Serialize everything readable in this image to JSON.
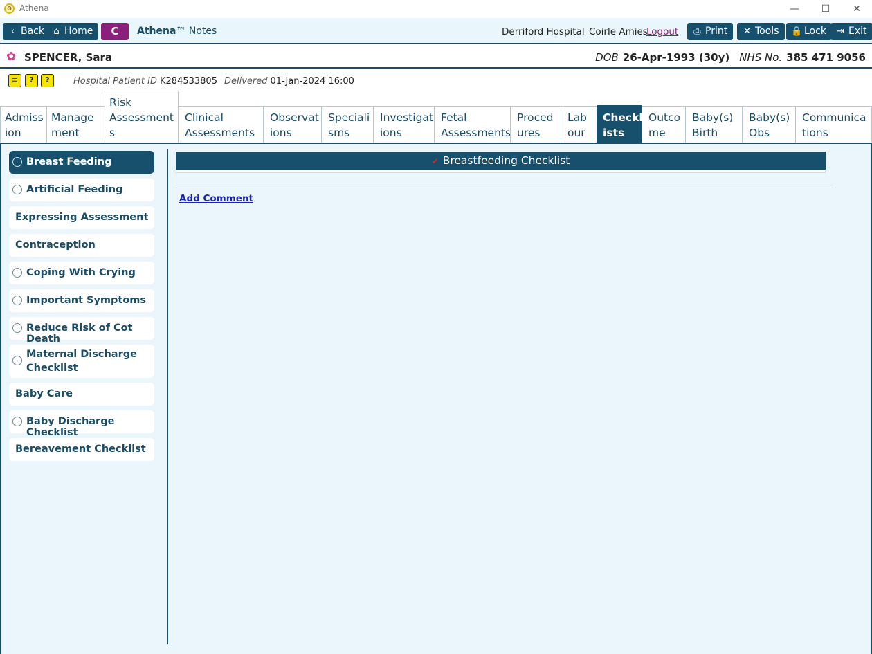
{
  "window": {
    "title": "Athena",
    "minimize": "—",
    "maximize": "☐",
    "close": "✕",
    "logo": "ʘ"
  },
  "toolbar": {
    "back": "Back",
    "back_icon": "‹",
    "home": "Home",
    "home_icon": "⌂",
    "c_button": "C",
    "brand": "Athena™",
    "brand_suffix": "Notes",
    "hospital": "Derriford Hospital",
    "user": "Coirle Amies",
    "logout": "Logout",
    "print": "Print",
    "print_icon": "⎙",
    "tools": "Tools",
    "tools_icon": "✕",
    "lock": "Lock",
    "lock_icon": "🔒",
    "exit": "Exit",
    "exit_icon": "⇥"
  },
  "patient": {
    "name": "SPENCER, Sara",
    "flower_icon": "✿",
    "dob_label": "DOB",
    "dob": "26-Apr-1993 (30y)",
    "nhs_label": "NHS No.",
    "nhs": "385 471 9056"
  },
  "info": {
    "icons": [
      "≡",
      "?",
      "?"
    ],
    "hospital_id_label": "Hospital Patient ID",
    "hospital_id": "K284533805",
    "delivered_label": "Delivered",
    "delivered": "01-Jan-2024 16:00"
  },
  "tabs": [
    {
      "line1": "Admiss",
      "line2": "ion"
    },
    {
      "line1": "Manage",
      "line2": "ment"
    },
    {
      "line1": "Risk",
      "line2": "Assessment",
      "line3": "s"
    },
    {
      "line1": "Clinical",
      "line2": "Assessments"
    },
    {
      "line1": "Observat",
      "line2": "ions"
    },
    {
      "line1": "Speciali",
      "line2": "sms"
    },
    {
      "line1": "Investigat",
      "line2": "ions"
    },
    {
      "line1": "Fetal",
      "line2": "Assessments"
    },
    {
      "line1": "Proced",
      "line2": "ures"
    },
    {
      "line1": "Lab",
      "line2": "our"
    },
    {
      "line1": "Checkl",
      "line2": "ists"
    },
    {
      "line1": "Outco",
      "line2": "me"
    },
    {
      "line1": "Baby(s)",
      "line2": "Birth"
    },
    {
      "line1": "Baby(s)",
      "line2": "Obs"
    },
    {
      "line1": "Communica",
      "line2": "tions"
    }
  ],
  "active_tab": "Checklists",
  "sidebar": {
    "items": [
      {
        "label": "Breast Feeding"
      },
      {
        "label": "Artificial Feeding"
      },
      {
        "label": "Expressing Assessment"
      },
      {
        "label": "Contraception"
      },
      {
        "label": "Coping With Crying"
      },
      {
        "label": "Important Symptoms"
      },
      {
        "label": "Reduce Risk of Cot Death"
      },
      {
        "label": "Maternal Discharge",
        "label2": "Checklist"
      },
      {
        "label": "Baby Care"
      },
      {
        "label": "Baby Discharge Checklist"
      },
      {
        "label": "Bereavement Checklist"
      }
    ]
  },
  "main": {
    "panel_title": "Breastfeeding Checklist",
    "tick_icon": "✔",
    "add_comment": "Add Comment"
  }
}
